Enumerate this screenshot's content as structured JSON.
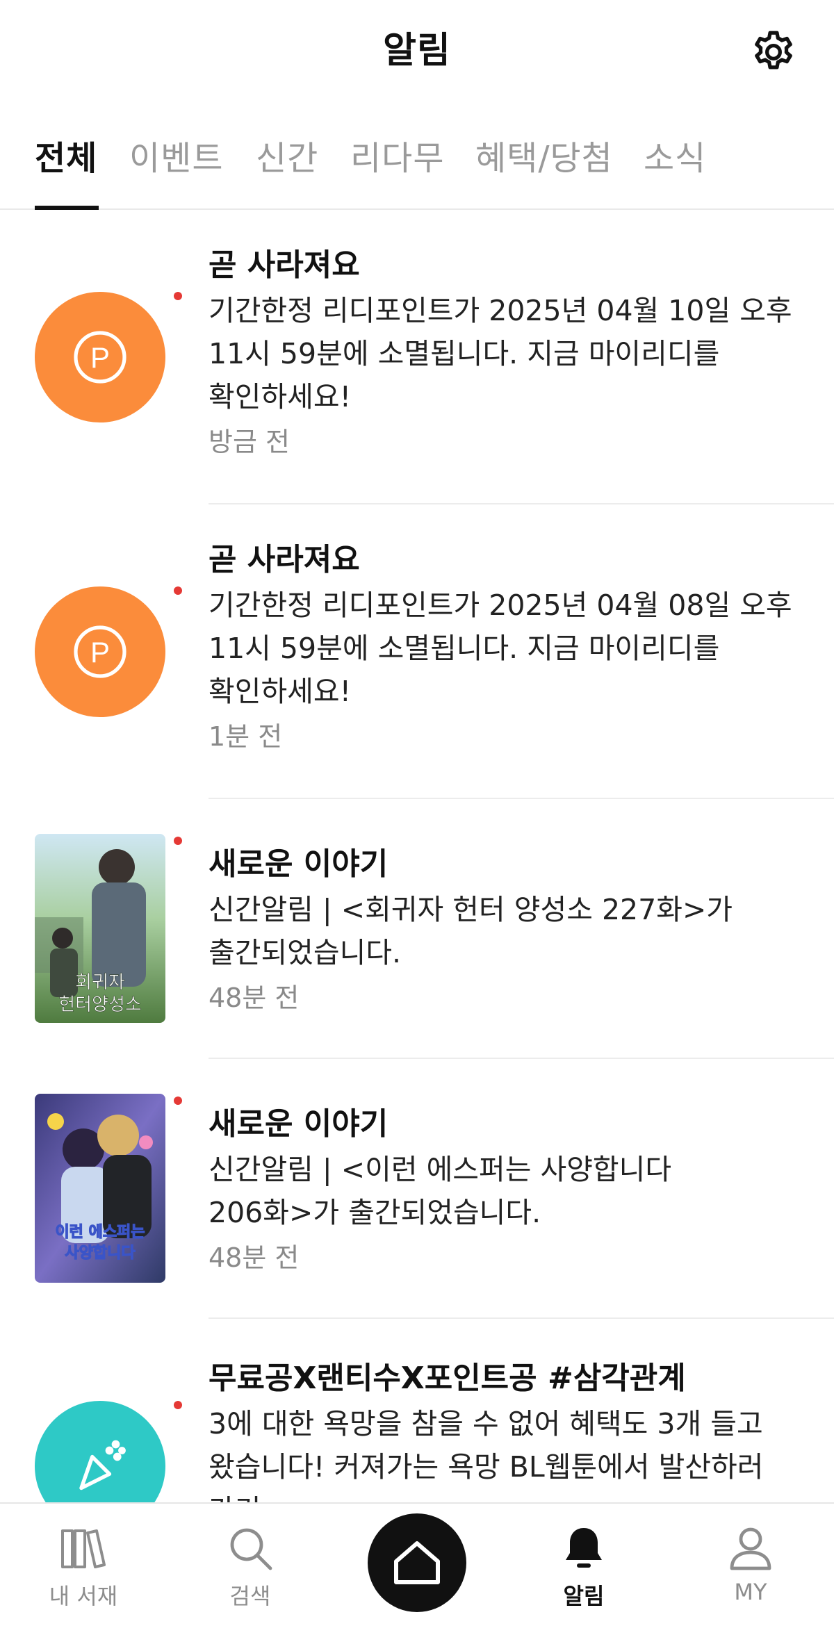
{
  "header": {
    "title": "알림",
    "settings_icon": "gear-icon"
  },
  "tabs": [
    {
      "label": "전체",
      "active": true
    },
    {
      "label": "이벤트",
      "active": false
    },
    {
      "label": "신간",
      "active": false
    },
    {
      "label": "리다무",
      "active": false
    },
    {
      "label": "혜택/당첨",
      "active": false
    },
    {
      "label": "소식",
      "active": false
    }
  ],
  "notifications": [
    {
      "type": "point",
      "icon": "point-icon",
      "title": "곧 사라져요",
      "body_lines": [
        "기간한정 리디포인트가 2025년 04월 10일 오후",
        "11시 59분에 소멸됩니다. 지금 마이리디를",
        "확인하세요!"
      ],
      "time": "방금 전",
      "unread": true
    },
    {
      "type": "point",
      "icon": "point-icon",
      "title": "곧 사라져요",
      "body_lines": [
        "기간한정 리디포인트가 2025년 04월 08일 오후",
        "11시 59분에 소멸됩니다. 지금 마이리디를",
        "확인하세요!"
      ],
      "time": "1분 전",
      "unread": true
    },
    {
      "type": "book",
      "cover_text": "회귀자 헌터양성소",
      "title": "새로운 이야기",
      "body_lines": [
        "신간알림 | <회귀자 헌터 양성소 227화>가",
        "출간되었습니다."
      ],
      "time": "48분 전",
      "unread": true
    },
    {
      "type": "book",
      "cover_text": "이런 에스퍼는 사양합니다",
      "title": "새로운 이야기",
      "body_lines": [
        "신간알림 | <이런 에스퍼는 사양합니다",
        "206화>가 출간되었습니다."
      ],
      "time": "48분 전",
      "unread": true
    },
    {
      "type": "event",
      "icon": "party-popper-icon",
      "title": "무료공X랜티수X포인트공 #삼각관계",
      "body_lines": [
        "3에 대한 욕망을 참을 수 없어 혜택도 3개 들고",
        "왔습니다! 커져가는 욕망 BL웹툰에서 발산하러",
        "가기"
      ],
      "time": "",
      "unread": true
    }
  ],
  "bottom_nav": [
    {
      "label": "내 서재",
      "icon": "library-icon",
      "active": false
    },
    {
      "label": "검색",
      "icon": "search-icon",
      "active": false
    },
    {
      "label": "",
      "icon": "home-icon",
      "active": false
    },
    {
      "label": "알림",
      "icon": "bell-icon",
      "active": true
    },
    {
      "label": "MY",
      "icon": "person-icon",
      "active": false
    }
  ],
  "colors": {
    "point_orange": "#fb8c3b",
    "event_teal": "#2ec9c6",
    "unread_dot": "#e53935",
    "text_primary": "#111111",
    "text_muted": "#8a8a8a"
  }
}
